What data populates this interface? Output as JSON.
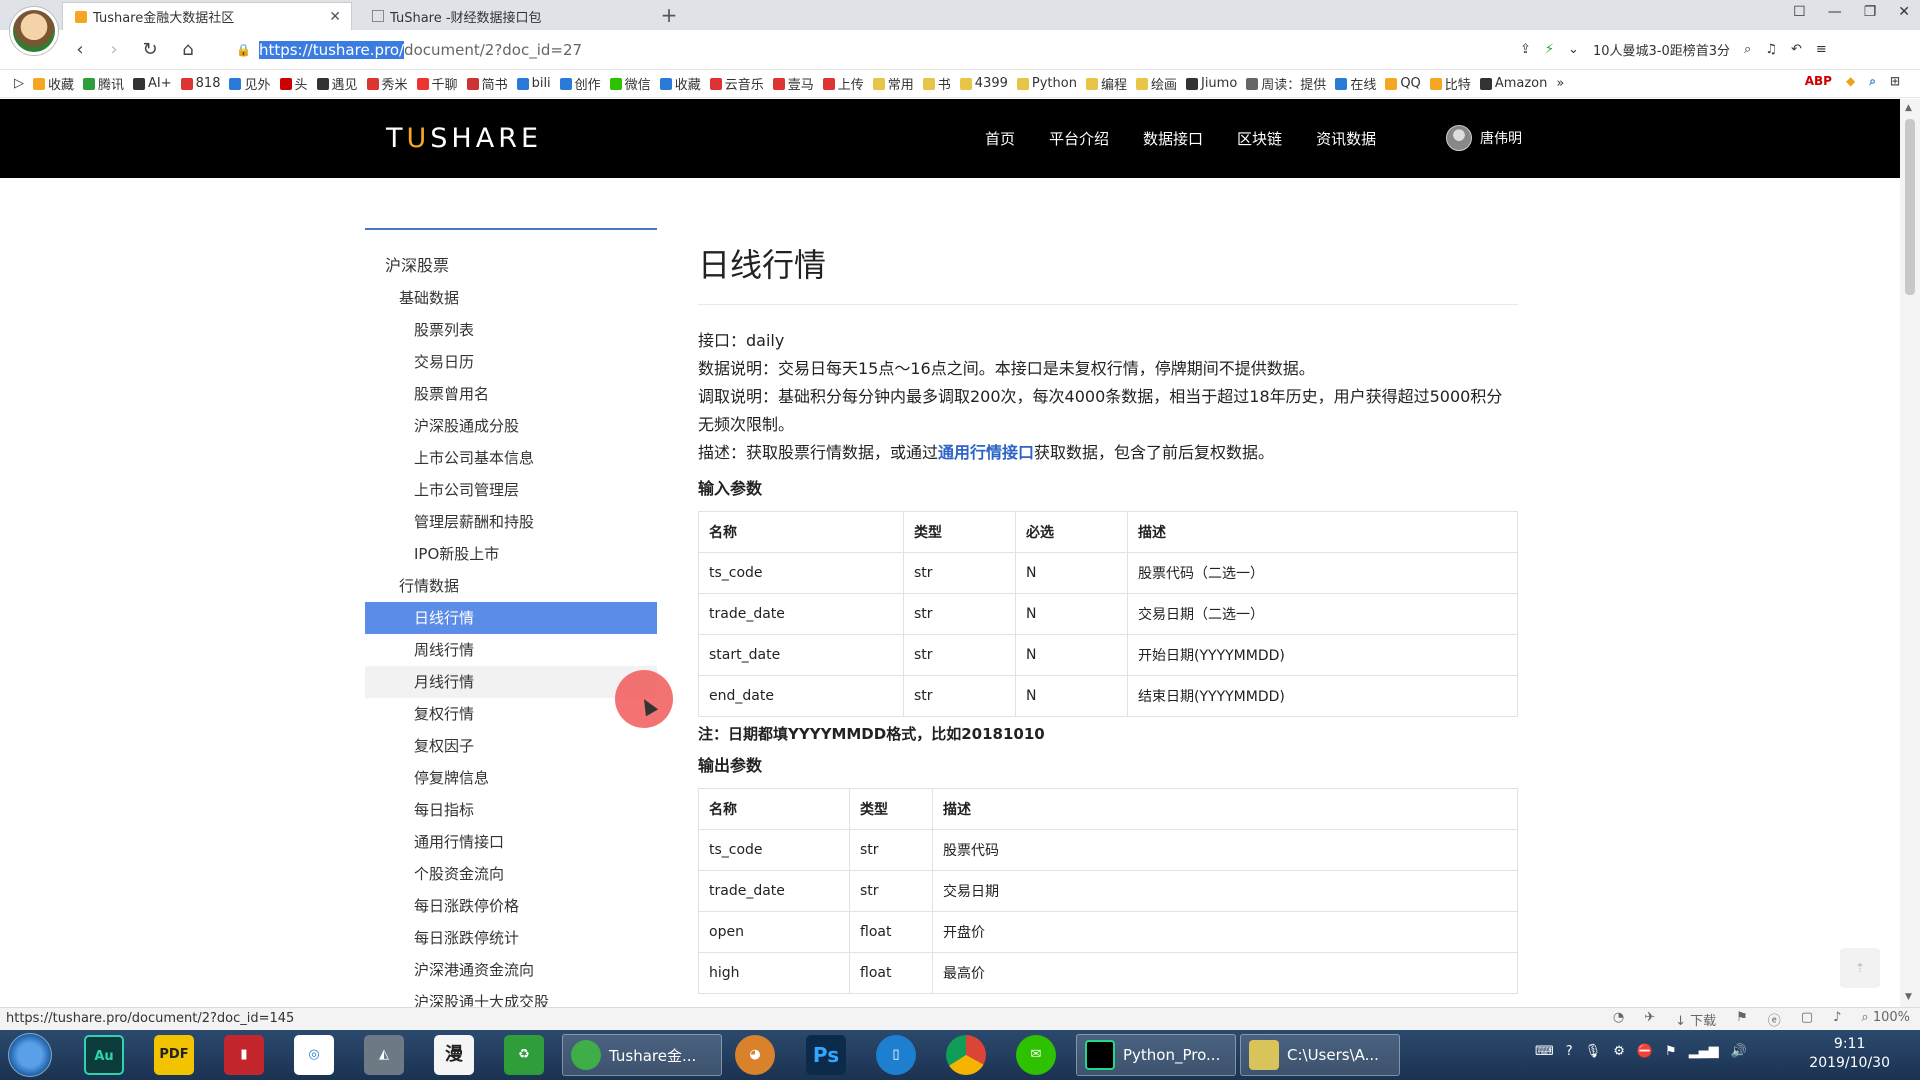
{
  "browser": {
    "tabs": [
      {
        "title": "Tushare金融大数据社区",
        "active": true
      },
      {
        "title": "TuShare -财经数据接口包",
        "active": false
      }
    ],
    "url_selected": "https://tushare.pro/",
    "url_rest": "document/2?doc_id=27",
    "news_ticker": "10人曼城3-0距榜首3分",
    "bookmarks": [
      "收藏",
      "腾讯",
      "AI+",
      "818",
      "见外",
      "头",
      "遇见",
      "秀米",
      "千聊",
      "简书",
      "bili",
      "创作",
      "微信",
      "收藏",
      "云音乐",
      "壹马",
      "上传",
      "常用",
      "书",
      "4399",
      "Python",
      "编程",
      "绘画",
      "Jiumo",
      "周读：提供",
      "在线",
      "QQ",
      "比特",
      "Amazon"
    ]
  },
  "site": {
    "logo": "TUSHARE",
    "nav": [
      "首页",
      "平台介绍",
      "数据接口",
      "区块链",
      "资讯数据"
    ],
    "user": "唐伟明"
  },
  "sidebar": {
    "items": [
      {
        "label": "沪深股票",
        "level": 1
      },
      {
        "label": "基础数据",
        "level": 2
      },
      {
        "label": "股票列表",
        "level": 3
      },
      {
        "label": "交易日历",
        "level": 3
      },
      {
        "label": "股票曾用名",
        "level": 3
      },
      {
        "label": "沪深股通成分股",
        "level": 3
      },
      {
        "label": "上市公司基本信息",
        "level": 3
      },
      {
        "label": "上市公司管理层",
        "level": 3
      },
      {
        "label": "管理层薪酬和持股",
        "level": 3
      },
      {
        "label": "IPO新股上市",
        "level": 3
      },
      {
        "label": "行情数据",
        "level": 2
      },
      {
        "label": "日线行情",
        "level": 3,
        "state": "active"
      },
      {
        "label": "周线行情",
        "level": 3
      },
      {
        "label": "月线行情",
        "level": 3,
        "state": "hover"
      },
      {
        "label": "复权行情",
        "level": 3
      },
      {
        "label": "复权因子",
        "level": 3
      },
      {
        "label": "停复牌信息",
        "level": 3
      },
      {
        "label": "每日指标",
        "level": 3
      },
      {
        "label": "通用行情接口",
        "level": 3
      },
      {
        "label": "个股资金流向",
        "level": 3
      },
      {
        "label": "每日涨跌停价格",
        "level": 3
      },
      {
        "label": "每日涨跌停统计",
        "level": 3
      },
      {
        "label": "沪深港通资金流向",
        "level": 3
      },
      {
        "label": "沪深股通十大成交股",
        "level": 3
      }
    ]
  },
  "content": {
    "title": "日线行情",
    "interface": "接口：daily",
    "data_desc": "数据说明：交易日每天15点～16点之间。本接口是未复权行情，停牌期间不提供数据。",
    "call_desc": "调取说明：基础积分每分钟内最多调取200次，每次4000条数据，相当于超过18年历史，用户获得超过5000积分无频次限制。",
    "desc_prefix": "描述：获取股票行情数据，或通过",
    "desc_link": "通用行情接口",
    "desc_suffix": "获取数据，包含了前后复权数据。",
    "input_title": "输入参数",
    "input_headers": [
      "名称",
      "类型",
      "必选",
      "描述"
    ],
    "input_rows": [
      [
        "ts_code",
        "str",
        "N",
        "股票代码（二选一）"
      ],
      [
        "trade_date",
        "str",
        "N",
        "交易日期（二选一）"
      ],
      [
        "start_date",
        "str",
        "N",
        "开始日期(YYYYMMDD)"
      ],
      [
        "end_date",
        "str",
        "N",
        "结束日期(YYYYMMDD)"
      ]
    ],
    "note": "注：日期都填YYYYMMDD格式，比如20181010",
    "output_title": "输出参数",
    "output_headers": [
      "名称",
      "类型",
      "描述"
    ],
    "output_rows": [
      [
        "ts_code",
        "str",
        "股票代码"
      ],
      [
        "trade_date",
        "str",
        "交易日期"
      ],
      [
        "open",
        "float",
        "开盘价"
      ],
      [
        "high",
        "float",
        "最高价"
      ]
    ]
  },
  "statusbar": {
    "url": "https://tushare.pro/document/2?doc_id=145",
    "download": "下载",
    "zoom": "100%"
  },
  "taskbar": {
    "windows": [
      {
        "title": "Tushare金..."
      },
      {
        "title": "Python_Pro..."
      },
      {
        "title": "C:\\Users\\A..."
      }
    ],
    "time": "9:11",
    "date": "2019/10/30"
  },
  "colors": {
    "header_bg": "#000000",
    "sidebar_active": "#5b8ce8",
    "link": "#2b63c6",
    "logo_accent": "#f5a623"
  }
}
